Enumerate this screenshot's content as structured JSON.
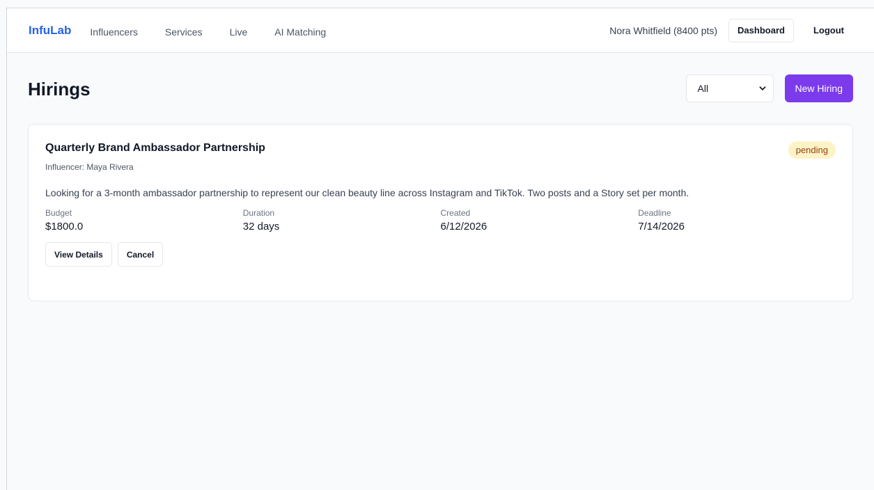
{
  "nav": {
    "brand": "InfuLab",
    "links": [
      "Influencers",
      "Services",
      "Live",
      "AI Matching"
    ],
    "user": "Nora Whitfield (8400 pts)",
    "dashboard_label": "Dashboard",
    "logout_label": "Logout"
  },
  "header": {
    "title": "Hirings",
    "filter_selected": "All",
    "new_label": "New Hiring"
  },
  "hirings": [
    {
      "title": "Quarterly Brand Ambassador Partnership",
      "influencer": "Influencer: Maya Rivera",
      "status": "pending",
      "description": "Looking for a 3-month ambassador partnership to represent our clean beauty line across Instagram and TikTok. Two posts and a Story set per month.",
      "meta": [
        {
          "label": "Budget",
          "value": "$1800.0"
        },
        {
          "label": "Duration",
          "value": "32 days"
        },
        {
          "label": "Created",
          "value": "6/12/2026"
        },
        {
          "label": "Deadline",
          "value": "7/14/2026"
        }
      ],
      "actions": {
        "view": "View Details",
        "cancel": "Cancel"
      }
    }
  ],
  "colors": {
    "brand": "#2563eb",
    "primary": "#7c3aed",
    "badge_bg": "#fef3c7",
    "badge_text": "#92400e"
  },
  "icons": {
    "filter_chevron": "chevron-down-icon"
  }
}
